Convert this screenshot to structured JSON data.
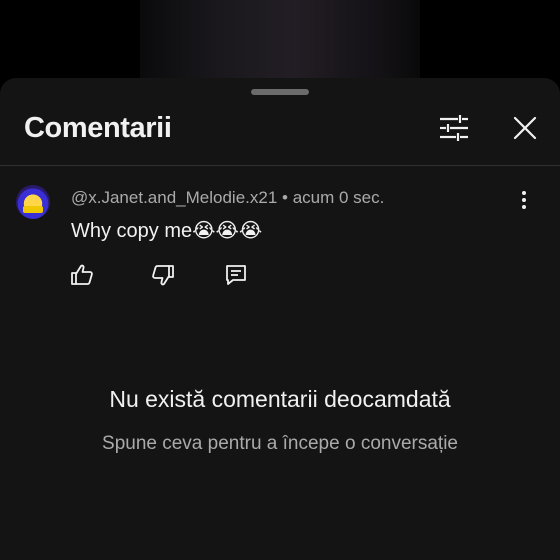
{
  "sheet": {
    "title": "Comentarii"
  },
  "comment": {
    "author": "@x.Janet.and_Melodie.x21",
    "separator": "•",
    "time": "acum 0 sec.",
    "text": "Why copy me😭😭😭"
  },
  "icons": {
    "filter": "sliders-icon",
    "close": "close-icon",
    "more": "more-vertical-icon",
    "like": "thumb-up-icon",
    "dislike": "thumb-down-icon",
    "reply": "comment-reply-icon"
  },
  "empty_state": {
    "title": "Nu există comentarii deocamdată",
    "subtitle": "Spune ceva pentru a începe o conversație"
  },
  "colors": {
    "sheet_bg": "#141414",
    "text_primary": "#f1f1f1",
    "text_secondary": "#aaaaaa"
  }
}
